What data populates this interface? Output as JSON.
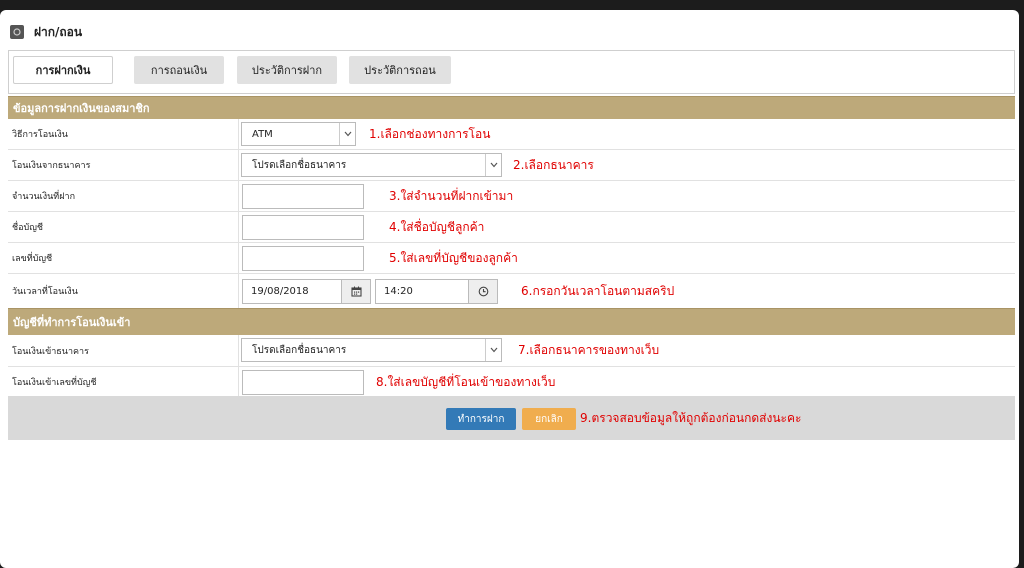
{
  "page": {
    "title": "ฝาก/ถอน"
  },
  "tabs": [
    {
      "label": "การฝากเงิน"
    },
    {
      "label": "การถอนเงิน"
    },
    {
      "label": "ประวัติการฝาก"
    },
    {
      "label": "ประวัติการถอน"
    }
  ],
  "section1": {
    "title": "ข้อมูลการฝากเงินของสมาชิก",
    "rows": [
      {
        "label": "วิธีการโอนเงิน",
        "value": "ATM",
        "note": "1.เลือกช่องทางการโอน"
      },
      {
        "label": "โอนเงินจากธนาคาร",
        "value": "โปรดเลือกชื่อธนาคาร",
        "note": "2.เลือกธนาคาร"
      },
      {
        "label": "จำนวนเงินที่ฝาก",
        "value": "",
        "note": "3.ใส่จำนวนที่ฝากเข้ามา"
      },
      {
        "label": "ชื่อบัญชี",
        "value": "",
        "note": "4.ใส่ชื่อบัญชีลูกค้า"
      },
      {
        "label": "เลขที่บัญชี",
        "value": "",
        "note": "5.ใส่เลขที่บัญชีของลูกค้า"
      },
      {
        "label": "วันเวลาที่โอนเงิน",
        "date": "19/08/2018",
        "time": "14:20",
        "note": "6.กรอกวันเวลาโอนตามสคริป"
      }
    ]
  },
  "section2": {
    "title": "บัญชีที่ทำการโอนเงินเข้า",
    "rows": [
      {
        "label": "โอนเงินเข้าธนาคาร",
        "value": "โปรดเลือกชื่อธนาคาร",
        "note": "7.เลือกธนาคารของทางเว็บ"
      },
      {
        "label": "โอนเงินเข้าเลขที่บัญชี",
        "value": "",
        "note": "8.ใส่เลขบัญชีที่โอนเข้าของทางเว็บ"
      }
    ]
  },
  "footer": {
    "submit_label": "ทำการฝาก",
    "cancel_label": "ยกเลิก",
    "note": "9.ตรวจสอบข้อมูลให้ถูกต้องก่อนกดส่งนะคะ"
  },
  "colors": {
    "header_bg": "#bda97a",
    "note_red": "#e00000",
    "submit_blue": "#337ab7",
    "cancel_orange": "#f0ad4e"
  },
  "icons": {
    "title": "app-icon",
    "select": "chevron-down-icon",
    "date": "calendar-icon",
    "time": "clock-icon"
  }
}
